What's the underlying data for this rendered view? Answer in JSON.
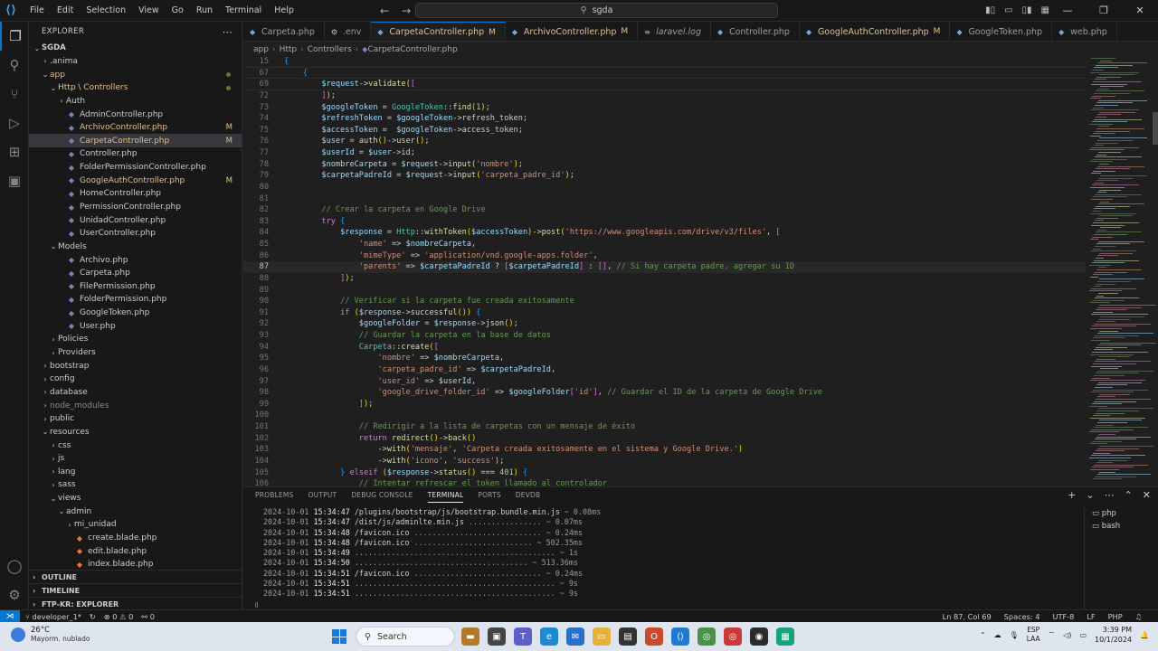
{
  "titlebar": {
    "menu": [
      "File",
      "Edit",
      "Selection",
      "View",
      "Go",
      "Run",
      "Terminal",
      "Help"
    ],
    "search": "sgda"
  },
  "sidebar": {
    "header": "EXPLORER",
    "root": "SGDA",
    "items": [
      {
        "label": ".anima",
        "depth": 1,
        "type": "folder",
        "open": false,
        "state": "normal"
      },
      {
        "label": "app",
        "depth": 1,
        "type": "folder",
        "open": true,
        "state": "mod",
        "dot": true
      },
      {
        "label": "Http \\ Controllers",
        "depth": 2,
        "type": "folder",
        "open": true,
        "state": "mod",
        "dot": true
      },
      {
        "label": "Auth",
        "depth": 3,
        "type": "folder",
        "open": false,
        "state": "normal"
      },
      {
        "label": "AdminController.php",
        "depth": 3,
        "type": "php",
        "state": "normal"
      },
      {
        "label": "ArchivoController.php",
        "depth": 3,
        "type": "php",
        "state": "mod",
        "badge": "M"
      },
      {
        "label": "CarpetaController.php",
        "depth": 3,
        "type": "php",
        "state": "mod",
        "badge": "M",
        "selected": true
      },
      {
        "label": "Controller.php",
        "depth": 3,
        "type": "php",
        "state": "normal"
      },
      {
        "label": "FolderPermissionController.php",
        "depth": 3,
        "type": "php",
        "state": "normal"
      },
      {
        "label": "GoogleAuthController.php",
        "depth": 3,
        "type": "php",
        "state": "mod",
        "badge": "M"
      },
      {
        "label": "HomeController.php",
        "depth": 3,
        "type": "php",
        "state": "normal"
      },
      {
        "label": "PermissionController.php",
        "depth": 3,
        "type": "php",
        "state": "normal"
      },
      {
        "label": "UnidadController.php",
        "depth": 3,
        "type": "php",
        "state": "normal"
      },
      {
        "label": "UserController.php",
        "depth": 3,
        "type": "php",
        "state": "normal"
      },
      {
        "label": "Models",
        "depth": 2,
        "type": "folder",
        "open": true,
        "state": "normal"
      },
      {
        "label": "Archivo.php",
        "depth": 3,
        "type": "php",
        "state": "normal"
      },
      {
        "label": "Carpeta.php",
        "depth": 3,
        "type": "php",
        "state": "normal"
      },
      {
        "label": "FilePermission.php",
        "depth": 3,
        "type": "php",
        "state": "normal"
      },
      {
        "label": "FolderPermission.php",
        "depth": 3,
        "type": "php",
        "state": "normal"
      },
      {
        "label": "GoogleToken.php",
        "depth": 3,
        "type": "php",
        "state": "normal"
      },
      {
        "label": "User.php",
        "depth": 3,
        "type": "php",
        "state": "normal"
      },
      {
        "label": "Policies",
        "depth": 2,
        "type": "folder",
        "open": false,
        "state": "normal"
      },
      {
        "label": "Providers",
        "depth": 2,
        "type": "folder",
        "open": false,
        "state": "normal"
      },
      {
        "label": "bootstrap",
        "depth": 1,
        "type": "folder",
        "open": false,
        "state": "normal"
      },
      {
        "label": "config",
        "depth": 1,
        "type": "folder",
        "open": false,
        "state": "normal"
      },
      {
        "label": "database",
        "depth": 1,
        "type": "folder",
        "open": false,
        "state": "normal"
      },
      {
        "label": "node_modules",
        "depth": 1,
        "type": "folder",
        "open": false,
        "state": "dim"
      },
      {
        "label": "public",
        "depth": 1,
        "type": "folder",
        "open": false,
        "state": "normal"
      },
      {
        "label": "resources",
        "depth": 1,
        "type": "folder",
        "open": true,
        "state": "normal"
      },
      {
        "label": "css",
        "depth": 2,
        "type": "folder",
        "open": false,
        "state": "normal"
      },
      {
        "label": "js",
        "depth": 2,
        "type": "folder",
        "open": false,
        "state": "normal"
      },
      {
        "label": "lang",
        "depth": 2,
        "type": "folder",
        "open": false,
        "state": "normal"
      },
      {
        "label": "sass",
        "depth": 2,
        "type": "folder",
        "open": false,
        "state": "normal"
      },
      {
        "label": "views",
        "depth": 2,
        "type": "folder",
        "open": true,
        "state": "normal"
      },
      {
        "label": "admin",
        "depth": 3,
        "type": "folder",
        "open": true,
        "state": "normal"
      },
      {
        "label": "mi_unidad",
        "depth": 4,
        "type": "folder",
        "open": false,
        "state": "normal"
      },
      {
        "label": "create.blade.php",
        "depth": 4,
        "type": "blade",
        "state": "normal"
      },
      {
        "label": "edit.blade.php",
        "depth": 4,
        "type": "blade",
        "state": "normal"
      },
      {
        "label": "index.blade.php",
        "depth": 4,
        "type": "blade",
        "state": "normal"
      }
    ],
    "sections": [
      "OUTLINE",
      "TIMELINE",
      "FTP-KR: EXPLORER"
    ]
  },
  "tabs": [
    {
      "label": "Carpeta.php",
      "active": false,
      "mod": false
    },
    {
      "label": ".env",
      "active": false,
      "mod": false
    },
    {
      "label": "CarpetaController.php",
      "active": true,
      "mod": true
    },
    {
      "label": "ArchivoController.php",
      "active": false,
      "mod": true
    },
    {
      "label": "laravel.log",
      "active": false,
      "mod": false,
      "italic": true
    },
    {
      "label": "Controller.php",
      "active": false,
      "mod": false
    },
    {
      "label": "GoogleAuthController.php",
      "active": false,
      "mod": true
    },
    {
      "label": "GoogleToken.php",
      "active": false,
      "mod": false
    },
    {
      "label": "web.php",
      "active": false,
      "mod": false
    }
  ],
  "breadcrumb": [
    "app",
    "Http",
    "Controllers",
    "CarpetaController.php"
  ],
  "code": [
    {
      "n": "15",
      "t": "{",
      "sticky": true
    },
    {
      "n": "67",
      "t": "    {",
      "sticky": true
    },
    {
      "n": "69",
      "t": "        $request->validate([",
      "sticky": true
    },
    {
      "n": "72",
      "t": "        ]);"
    },
    {
      "n": "73",
      "t": "        $googleToken = GoogleToken::find(1);"
    },
    {
      "n": "74",
      "t": "        $refreshToken = $googleToken->refresh_token;"
    },
    {
      "n": "75",
      "t": "        $accessToken =  $googleToken->access_token;"
    },
    {
      "n": "76",
      "t": "        $user = auth()->user();"
    },
    {
      "n": "77",
      "t": "        $userId = $user->id;"
    },
    {
      "n": "78",
      "t": "        $nombreCarpeta = $request->input('nombre');"
    },
    {
      "n": "79",
      "t": "        $carpetaPadreId = $request->input('carpeta_padre_id');"
    },
    {
      "n": "80",
      "t": ""
    },
    {
      "n": "81",
      "t": ""
    },
    {
      "n": "82",
      "t": "        // Crear la carpeta en Google Drive"
    },
    {
      "n": "83",
      "t": "        try {"
    },
    {
      "n": "84",
      "t": "            $response = Http::withToken($accessToken)->post('https://www.googleapis.com/drive/v3/files', ["
    },
    {
      "n": "85",
      "t": "                'name' => $nombreCarpeta,"
    },
    {
      "n": "86",
      "t": "                'mimeType' => 'application/vnd.google-apps.folder',"
    },
    {
      "n": "87",
      "t": "                'parents' => $carpetaPadreId ? [$carpetaPadreId] : [], // Si hay carpeta padre, agregar su ID",
      "current": true
    },
    {
      "n": "88",
      "t": "            ]);"
    },
    {
      "n": "89",
      "t": ""
    },
    {
      "n": "90",
      "t": "            // Verificar si la carpeta fue creada exitosamente"
    },
    {
      "n": "91",
      "t": "            if ($response->successful()) {"
    },
    {
      "n": "92",
      "t": "                $googleFolder = $response->json();"
    },
    {
      "n": "93",
      "t": "                // Guardar la carpeta en la base de datos"
    },
    {
      "n": "94",
      "t": "                Carpeta::create(["
    },
    {
      "n": "95",
      "t": "                    'nombre' => $nombreCarpeta,"
    },
    {
      "n": "96",
      "t": "                    'carpeta_padre_id' => $carpetaPadreId,"
    },
    {
      "n": "97",
      "t": "                    'user_id' => $userId,"
    },
    {
      "n": "98",
      "t": "                    'google_drive_folder_id' => $googleFolder['id'], // Guardar el ID de la carpeta de Google Drive"
    },
    {
      "n": "99",
      "t": "                ]);"
    },
    {
      "n": "100",
      "t": ""
    },
    {
      "n": "101",
      "t": "                // Redirigir a la lista de carpetas con un mensaje de éxito"
    },
    {
      "n": "102",
      "t": "                return redirect()->back()"
    },
    {
      "n": "103",
      "t": "                    ->with('mensaje', 'Carpeta creada exitosamente en el sistema y Google Drive.')"
    },
    {
      "n": "104",
      "t": "                    ->with('icono', 'success');"
    },
    {
      "n": "105",
      "t": "            } elseif ($response->status() === 401) {"
    },
    {
      "n": "106",
      "t": "                // Intentar refrescar el token llamado al controlador"
    }
  ],
  "panel": {
    "tabs": [
      "PROBLEMS",
      "OUTPUT",
      "DEBUG CONSOLE",
      "TERMINAL",
      "PORTS",
      "DEVDB"
    ],
    "active": "TERMINAL",
    "terminal": [
      {
        "date": "2024-10-01",
        "time": "15:34:47",
        "path": " /plugins/bootstrap/js/bootstrap.bundle.min.js",
        "dots": " ~ ",
        "dur": "0.08ms"
      },
      {
        "date": "2024-10-01",
        "time": "15:34:47",
        "path": " /dist/js/adminlte.min.js",
        "dots": " ................ ~ ",
        "dur": "0.07ms"
      },
      {
        "date": "2024-10-01",
        "time": "15:34:48",
        "path": " /favicon.ico",
        "dots": " ............................ ~ ",
        "dur": "0.24ms"
      },
      {
        "date": "2024-10-01",
        "time": "15:34:48",
        "path": " /favicon.ico",
        "dots": " .......................... ~ ",
        "dur": "502.35ms"
      },
      {
        "date": "2024-10-01",
        "time": "15:34:49",
        "path": " ",
        "dots": "............................................ ~ ",
        "dur": "1s"
      },
      {
        "date": "2024-10-01",
        "time": "15:34:50",
        "path": " ",
        "dots": "...................................... ~ ",
        "dur": "513.36ms"
      },
      {
        "date": "2024-10-01",
        "time": "15:34:51",
        "path": " /favicon.ico",
        "dots": " ............................ ~ ",
        "dur": "0.24ms"
      },
      {
        "date": "2024-10-01",
        "time": "15:34:51",
        "path": " ",
        "dots": "............................................ ~ ",
        "dur": "9s"
      },
      {
        "date": "2024-10-01",
        "time": "15:34:51",
        "path": " ",
        "dots": "............................................ ~ ",
        "dur": "9s"
      }
    ],
    "terminals": [
      "php",
      "bash"
    ]
  },
  "statusbar": {
    "branch": "developer_1*",
    "problems_errors": "0",
    "problems_warnings": "0",
    "ports": "0",
    "position": "Ln 87, Col 69",
    "spaces": "Spaces: 4",
    "encoding": "UTF-8",
    "eol": "LF",
    "language": "PHP"
  },
  "taskbar": {
    "temperature": "26°C",
    "weather": "Mayorm. nublado",
    "search": "Search",
    "lang_top": "ESP",
    "lang_bottom": "LAA",
    "time": "3:39 PM",
    "date": "10/1/2024"
  }
}
